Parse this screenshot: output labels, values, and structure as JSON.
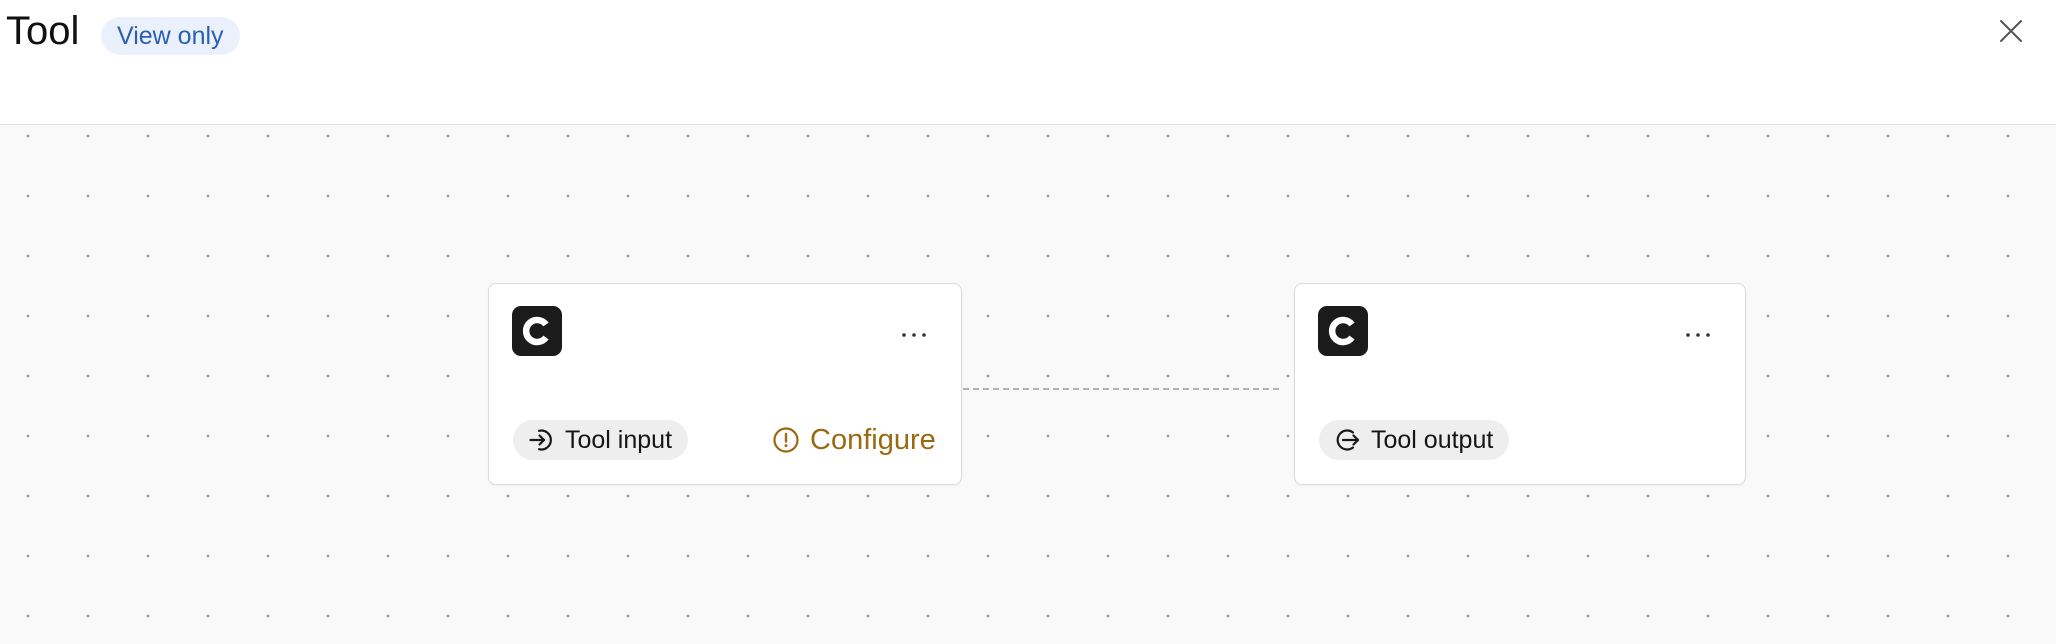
{
  "header": {
    "title": "Tool",
    "badge": "View only",
    "close_icon": "close-icon"
  },
  "nodes": [
    {
      "id": "input-node",
      "logo_letter": "C",
      "menu_icon": "more-horizontal-icon",
      "pill_icon": "sign-in-icon",
      "pill_label": "Tool input",
      "status_icon": "warning-circle-icon",
      "status_label": "Configure"
    },
    {
      "id": "output-node",
      "logo_letter": "C",
      "menu_icon": "more-horizontal-icon",
      "pill_icon": "sign-out-icon",
      "pill_label": "Tool output"
    }
  ],
  "colors": {
    "accent_blue": "#2a5fb3",
    "badge_bg": "#eaf1fc",
    "warning": "#9a6912",
    "logo_bg": "#1b1b1b",
    "canvas_bg": "#f9f9f9"
  }
}
